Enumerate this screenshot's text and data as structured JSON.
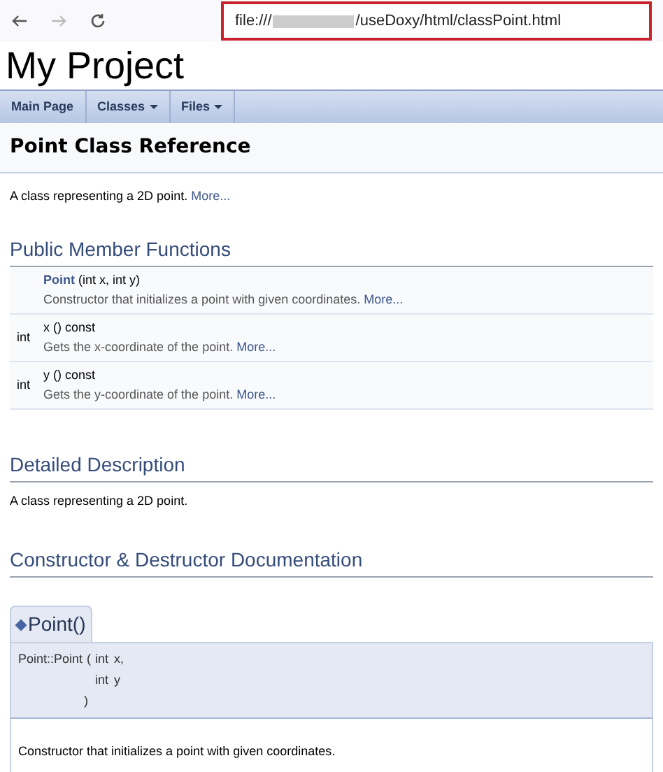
{
  "browser": {
    "url_prefix": "file:///",
    "url_suffix": "/useDoxy/html/classPoint.html",
    "url_blurred": true,
    "url_highlighted": true
  },
  "project_title": "My Project",
  "nav": [
    {
      "label": "Main Page",
      "dropdown": false
    },
    {
      "label": "Classes",
      "dropdown": true
    },
    {
      "label": "Files",
      "dropdown": true
    }
  ],
  "page_title": "Point Class Reference",
  "brief": {
    "text": "A class representing a 2D point.",
    "more": "More..."
  },
  "public_member_functions": {
    "heading": "Public Member Functions",
    "rows": [
      {
        "type": "",
        "name": "Point",
        "linked": true,
        "signature": " (int x, int y)",
        "description": "Constructor that initializes a point with given coordinates.",
        "more": "More..."
      },
      {
        "type": "int",
        "name": "x",
        "linked": false,
        "signature": " () const",
        "description": "Gets the x-coordinate of the point.",
        "more": "More..."
      },
      {
        "type": "int",
        "name": "y",
        "linked": false,
        "signature": " () const",
        "description": "Gets the y-coordinate of the point.",
        "more": "More..."
      }
    ]
  },
  "detailed_description": {
    "heading": "Detailed Description",
    "text": "A class representing a 2D point."
  },
  "constructor_docs": {
    "heading": "Constructor & Destructor Documentation",
    "member": {
      "tab_title": "Point()",
      "name": "Point::Point",
      "open_paren": "(",
      "params": [
        {
          "type": "int",
          "name": "x,"
        },
        {
          "type": "int",
          "name": "y"
        }
      ],
      "close_paren": ")",
      "description": "Constructor that initializes a point with given coordinates."
    }
  }
}
